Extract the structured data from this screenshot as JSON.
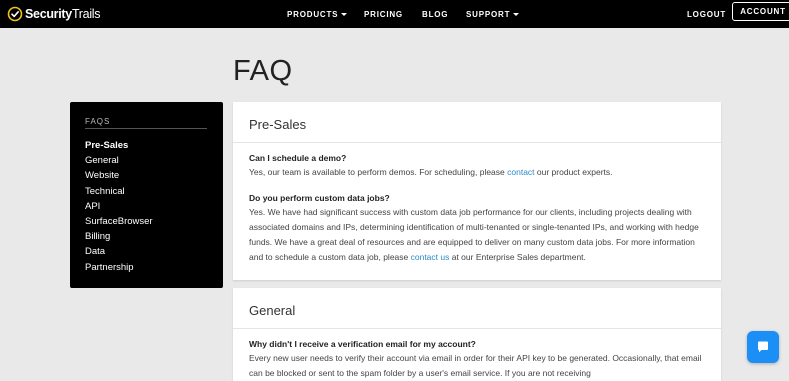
{
  "header": {
    "logo_bold": "Security",
    "logo_thin": "Trails",
    "nav": {
      "products": "PRODUCTS",
      "pricing": "PRICING",
      "blog": "BLOG",
      "support": "SUPPORT",
      "logout": "LOGOUT",
      "account": "ACCOUNT"
    }
  },
  "page": {
    "title": "FAQ"
  },
  "sidebar": {
    "heading": "FAQS",
    "items": [
      "Pre-Sales",
      "General",
      "Website",
      "Technical",
      "API",
      "SurfaceBrowser",
      "Billing",
      "Data",
      "Partnership"
    ],
    "active": "Pre-Sales"
  },
  "presales": {
    "title": "Pre-Sales",
    "q1": "Can I schedule a demo?",
    "a1_pre": "Yes, our team is available to perform demos. For scheduling, please ",
    "a1_link": "contact",
    "a1_post": " our product experts.",
    "q2": "Do you perform custom data jobs?",
    "a2_pre": "Yes. We have had significant success with custom data job performance for our clients, including projects dealing with associated domains and IPs, determining identification of multi-tenanted or single-tenanted IPs, and working with hedge funds. We have a great deal of resources and are equipped to deliver on many custom data jobs. For more information and to schedule a custom data job, please ",
    "a2_link": "contact us",
    "a2_post": " at our Enterprise Sales department."
  },
  "general": {
    "title": "General",
    "q1": "Why didn't I receive a verification email for my account?",
    "a1": "Every new user needs to verify their account via email in order for their API key to be generated. Occasionally, that email can be blocked or sent to the spam folder by a user's email service. If you are not receiving"
  },
  "icons": {
    "logo": "check-circle-icon",
    "chat": "chat-bubble-icon"
  },
  "colors": {
    "link": "#2a8dc7",
    "chat": "#1b8ff5"
  }
}
